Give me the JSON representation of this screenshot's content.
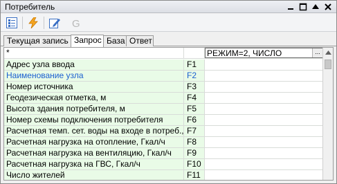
{
  "window": {
    "title": "Потребитель"
  },
  "toolbar": {
    "buttons": [
      {
        "name": "list-view-icon"
      },
      {
        "name": "lightning-icon"
      },
      {
        "name": "edit-icon"
      },
      {
        "name": "g-icon",
        "label": "G"
      }
    ]
  },
  "tabs": [
    {
      "label": "Текущая запись"
    },
    {
      "label": "Запрос"
    },
    {
      "label": "База"
    },
    {
      "label": "Ответ"
    }
  ],
  "grid": {
    "header": {
      "name": "*",
      "code": "",
      "value": "РЕЖИМ=2, ЧИСЛО",
      "button": "..."
    },
    "rows": [
      {
        "name": "Адрес узла ввода",
        "code": "F1"
      },
      {
        "name": "Наименование узла",
        "code": "F2",
        "highlight": "#1a5fd0"
      },
      {
        "name": "Номер источника",
        "code": "F3"
      },
      {
        "name": "Геодезическая отметка, м",
        "code": "F4"
      },
      {
        "name": "Высота здания потребителя, м",
        "code": "F5"
      },
      {
        "name": "Номер схемы подключения потребителя",
        "code": "F6"
      },
      {
        "name": "Расчетная темп. сет. воды на входе в потреб.,°C",
        "code": "F7"
      },
      {
        "name": "Расчетная нагрузка на отопление, Гкал/ч",
        "code": "F8"
      },
      {
        "name": "Расчетная нагрузка на вентиляцию, Гкал/ч",
        "code": "F9"
      },
      {
        "name": "Расчетная нагрузка на ГВС, Гкал/ч",
        "code": "F10"
      },
      {
        "name": "Число жителей",
        "code": "F11"
      }
    ]
  },
  "colors": {
    "row_background": "#e9fbe7",
    "selected_text": "#1a5fd0"
  }
}
